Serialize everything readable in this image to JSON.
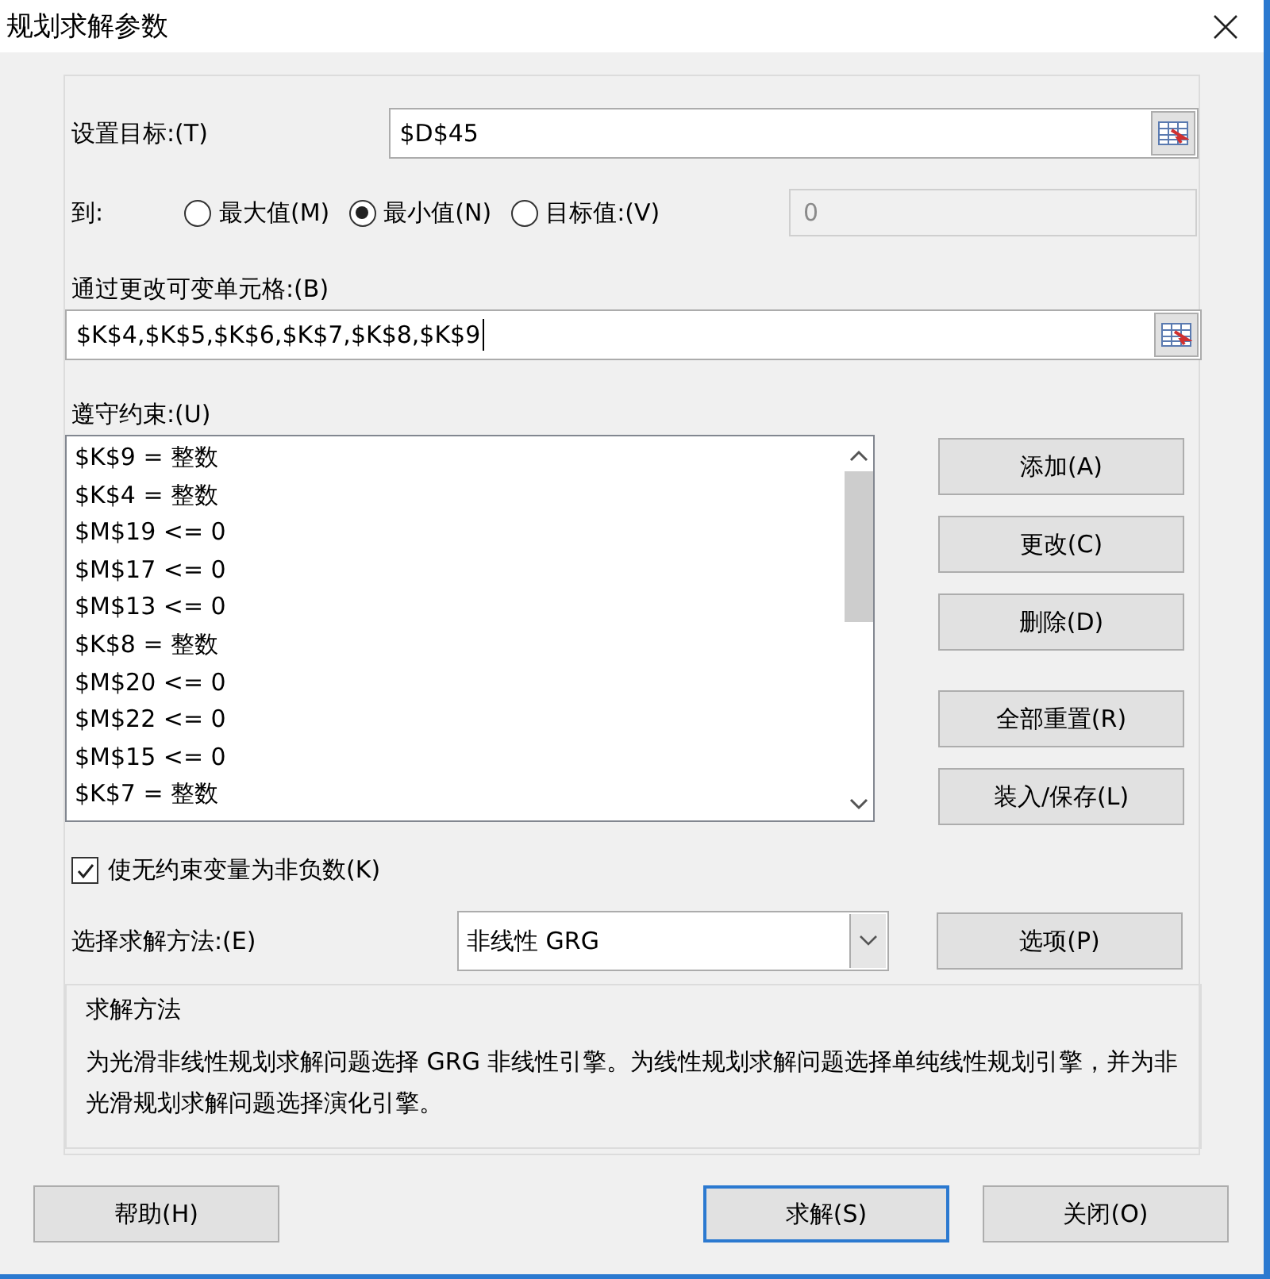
{
  "window": {
    "title": "规划求解参数"
  },
  "objective": {
    "label": "设置目标:(T)",
    "value": "$D$45"
  },
  "to": {
    "label": "到:",
    "options": [
      {
        "label": "最大值(M)",
        "selected": false
      },
      {
        "label": "最小值(N)",
        "selected": true
      },
      {
        "label": "目标值:(V)",
        "selected": false
      }
    ],
    "target_value": {
      "value": "0",
      "disabled": true
    }
  },
  "changing_cells": {
    "label": "通过更改可变单元格:(B)",
    "value": "$K$4,$K$5,$K$6,$K$7,$K$8,$K$9"
  },
  "constraints": {
    "label": "遵守约束:(U)",
    "items": [
      "$K$9 = 整数",
      "$K$4 = 整数",
      "$M$19 <= 0",
      "$M$17 <= 0",
      "$M$13 <= 0",
      "$K$8 = 整数",
      "$M$20 <= 0",
      "$M$22 <= 0",
      "$M$15 <= 0",
      "$K$7 = 整数"
    ]
  },
  "constraint_button_groups": [
    [
      "添加(A)",
      "更改(C)",
      "删除(D)"
    ],
    [
      "全部重置(R)",
      "装入/保存(L)"
    ]
  ],
  "nonnegative": {
    "label": "使无约束变量为非负数(K)",
    "checked": true
  },
  "method": {
    "label": "选择求解方法:(E)",
    "value": "非线性 GRG"
  },
  "options_button": "选项(P)",
  "description": {
    "title": "求解方法",
    "text": "为光滑非线性规划求解问题选择 GRG 非线性引擎。为线性规划求解问题选择单纯线性规划引擎，并为非光滑规划求解问题选择演化引擎。"
  },
  "footer_buttons": [
    {
      "label": "帮助(H)",
      "default": false
    },
    {
      "label": "求解(S)",
      "default": true
    },
    {
      "label": "关闭(O)",
      "default": false
    }
  ]
}
